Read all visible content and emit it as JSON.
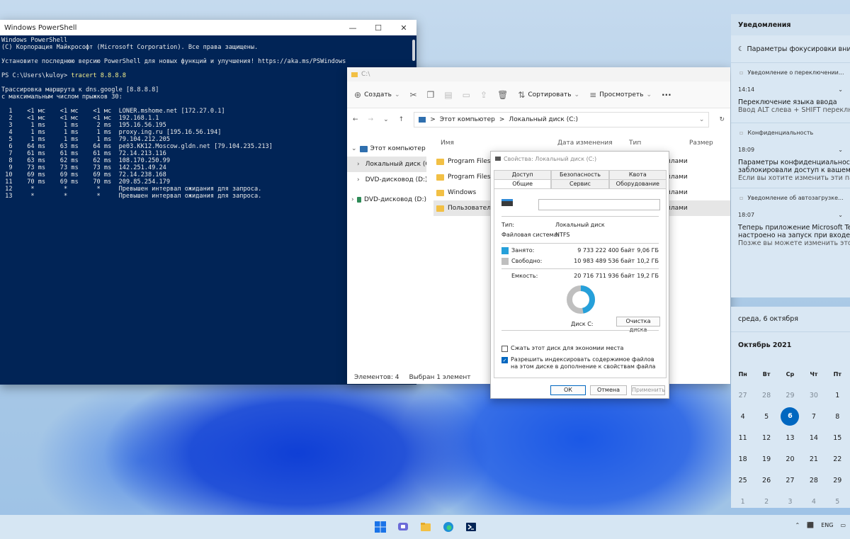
{
  "powershell": {
    "title": "Windows PowerShell",
    "lines": [
      {
        "text": "Windows PowerShell"
      },
      {
        "text": "(C) Корпорация Майкрософт (Microsoft Corporation). Все права защищены."
      },
      {
        "text": ""
      },
      {
        "text": "Установите последнюю версию PowerShell для новых функций и улучшения! https://aka.ms/PSWindows"
      },
      {
        "text": ""
      },
      {
        "text": "PS C:\\Users\\kuloy> ",
        "cmd": "tracert 8.8.8.8"
      },
      {
        "text": ""
      },
      {
        "text": "Трассировка маршрута к dns.google [8.8.8.8]"
      },
      {
        "text": "с максимальным числом прыжков 30:"
      },
      {
        "text": ""
      },
      {
        "text": "  1    <1 мс    <1 мс    <1 мс  LONER.mshome.net [172.27.0.1]"
      },
      {
        "text": "  2    <1 мс    <1 мс    <1 мс  192.168.1.1"
      },
      {
        "text": "  3     1 ms     1 ms     2 ms  195.16.56.195"
      },
      {
        "text": "  4     1 ms     1 ms     1 ms  proxy.ing.ru [195.16.56.194]"
      },
      {
        "text": "  5     1 ms     1 ms     1 ms  79.104.212.205"
      },
      {
        "text": "  6    64 ms    63 ms    64 ms  pe03.KK12.Moscow.gldn.net [79.104.235.213]"
      },
      {
        "text": "  7    61 ms    61 ms    61 ms  72.14.213.116"
      },
      {
        "text": "  8    63 ms    62 ms    62 ms  108.170.250.99"
      },
      {
        "text": "  9    73 ms    73 ms    73 ms  142.251.49.24"
      },
      {
        "text": " 10    69 ms    69 ms    69 ms  72.14.238.168"
      },
      {
        "text": " 11    70 ms    69 ms    70 ms  209.85.254.179"
      },
      {
        "text": " 12     *        *        *     Превышен интервал ожидания для запроса."
      },
      {
        "text": " 13     *        *        *     Превышен интервал ожидания для запроса."
      }
    ]
  },
  "explorer": {
    "title": "C:\\",
    "toolbar": {
      "create": "Создать",
      "sort": "Сортировать",
      "view": "Просмотреть",
      "more": "···"
    },
    "address": {
      "computer": "Этот компьютер",
      "drive": "Локальный диск (C:)",
      "sep": ">"
    },
    "columns": {
      "name": "Имя",
      "date": "Дата изменения",
      "type": "Тип",
      "size": "Размер"
    },
    "nav": [
      {
        "label": "Этот компьютер",
        "icon": "computer-icon"
      },
      {
        "label": "Локальный диск (C:)",
        "icon": "drive-icon"
      },
      {
        "label": "DVD-дисковод (D:)",
        "icon": "dvd-icon"
      },
      {
        "label": "DVD-дисковод (D:)",
        "icon": "dvd-icon"
      }
    ],
    "rows": [
      {
        "name": "Program Files",
        "type": "Папка с файлами"
      },
      {
        "name": "Program Files (x86)",
        "type": "Папка с файлами"
      },
      {
        "name": "Windows",
        "type": "Папка с файлами"
      },
      {
        "name": "Пользователи",
        "type": "Папка с файлами"
      }
    ],
    "status": {
      "count": "Элементов: 4",
      "selected": "Выбран 1 элемент"
    }
  },
  "dialog": {
    "title": "Свойства: Локальный диск (C:)",
    "tabs_row1": [
      "Доступ",
      "Безопасность",
      "Квота"
    ],
    "tabs_row2": [
      "Общие",
      "Сервис",
      "Оборудование"
    ],
    "name_value": "",
    "type_label": "Тип:",
    "type_value": "Локальный диск",
    "fs_label": "Файловая система:",
    "fs_value": "NTFS",
    "used_label": "Занято:",
    "used_bytes": "9 733 222 400 байт",
    "used_gb": "9,06 ГБ",
    "free_label": "Свободно:",
    "free_bytes": "10 983 489 536 байт",
    "free_gb": "10,2 ГБ",
    "cap_label": "Емкость:",
    "cap_bytes": "20 716 711 936 байт",
    "cap_gb": "19,2 ГБ",
    "used_fraction": 0.47,
    "used_color": "#26a0da",
    "free_color": "#bfbfbf",
    "disk_label": "Диск C:",
    "cleanup": "Очистка диска",
    "compress": "Сжать этот диск для экономии места",
    "index": "Разрешить индексировать содержимое файлов на этом диске в дополнение к свойствам файла",
    "ok": "ОК",
    "cancel": "Отмена",
    "apply": "Применить"
  },
  "notifications": {
    "header": "Уведомления",
    "focus": "Параметры фокусировки внимания",
    "items": [
      {
        "app": "Уведомление о переключении...",
        "time": "14:14",
        "title": "Переключение языка ввода",
        "body": "Ввод ALT слева + SHIFT переключает"
      },
      {
        "app": "Конфиденциальность",
        "time": "18:09",
        "title": "Параметры конфиденциальности",
        "title2": "заблокировали доступ к вашему м",
        "body": "Если вы хотите изменить эти парам"
      },
      {
        "app": "Уведомление об автозагрузке...",
        "time": "18:07",
        "title": "Теперь приложение Microsoft Teams",
        "title2": "настроено на запуск при входе в с",
        "body": "Позже вы можете изменить этот па"
      }
    ]
  },
  "calendar": {
    "date_header": "среда, 6 октября",
    "month": "Октябрь 2021",
    "weekdays": [
      "Пн",
      "Вт",
      "Ср",
      "Чт",
      "Пт"
    ],
    "weeks": [
      [
        {
          "d": "27",
          "dim": true
        },
        {
          "d": "28",
          "dim": true
        },
        {
          "d": "29",
          "dim": true
        },
        {
          "d": "30",
          "dim": true
        },
        {
          "d": "1"
        }
      ],
      [
        {
          "d": "4"
        },
        {
          "d": "5"
        },
        {
          "d": "6",
          "today": true
        },
        {
          "d": "7"
        },
        {
          "d": "8"
        }
      ],
      [
        {
          "d": "11"
        },
        {
          "d": "12"
        },
        {
          "d": "13"
        },
        {
          "d": "14"
        },
        {
          "d": "15"
        }
      ],
      [
        {
          "d": "18"
        },
        {
          "d": "19"
        },
        {
          "d": "20"
        },
        {
          "d": "21"
        },
        {
          "d": "22"
        }
      ],
      [
        {
          "d": "25"
        },
        {
          "d": "26"
        },
        {
          "d": "27"
        },
        {
          "d": "28"
        },
        {
          "d": "29"
        }
      ],
      [
        {
          "d": "1",
          "dim": true
        },
        {
          "d": "2",
          "dim": true
        },
        {
          "d": "3",
          "dim": true
        },
        {
          "d": "4",
          "dim": true
        },
        {
          "d": "5",
          "dim": true
        }
      ]
    ]
  },
  "taskbar": {
    "apps": [
      "start-icon",
      "teams-chat-icon",
      "file-explorer-icon",
      "edge-icon",
      "powershell-icon"
    ],
    "lang": "ENG"
  }
}
